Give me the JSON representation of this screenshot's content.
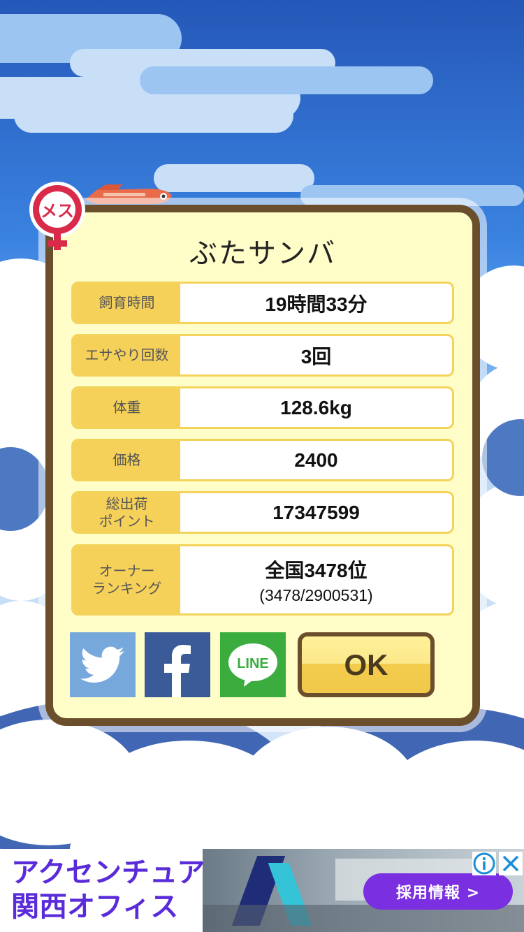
{
  "pet": {
    "name": "ぶたサンバ",
    "gender_badge": "メス"
  },
  "stats": [
    {
      "label": "飼育時間",
      "value": "19時間33分"
    },
    {
      "label": "エサやり回数",
      "value": "3回"
    },
    {
      "label": "体重",
      "value": "128.6kg"
    },
    {
      "label": "価格",
      "value": "2400"
    },
    {
      "label_line1": "総出荷",
      "label_line2": "ポイント",
      "value": "17347599"
    },
    {
      "label_line1": "オーナー",
      "label_line2": "ランキング",
      "value": "全国3478位",
      "sub": "(3478/2900531)"
    }
  ],
  "share": {
    "twitter_icon": "twitter-bird-icon",
    "facebook_icon": "facebook-f-icon",
    "line_label": "LINE"
  },
  "ok_label": "OK",
  "ad": {
    "title_line1": "アクセンチュア",
    "title_line2": "関西オフィス",
    "button_label": "採用情報 >",
    "info_icon": "info-icon",
    "close_icon": "close-icon"
  },
  "colors": {
    "dialog_bg": "#fffdc8",
    "dialog_border": "#6b4f2c",
    "label_bg": "#f6d15a",
    "twitter": "#76a8dc",
    "facebook": "#3a5a98",
    "line": "#3aad3e",
    "female_badge": "#d92a4a",
    "ad_accent": "#7a2fe0"
  }
}
